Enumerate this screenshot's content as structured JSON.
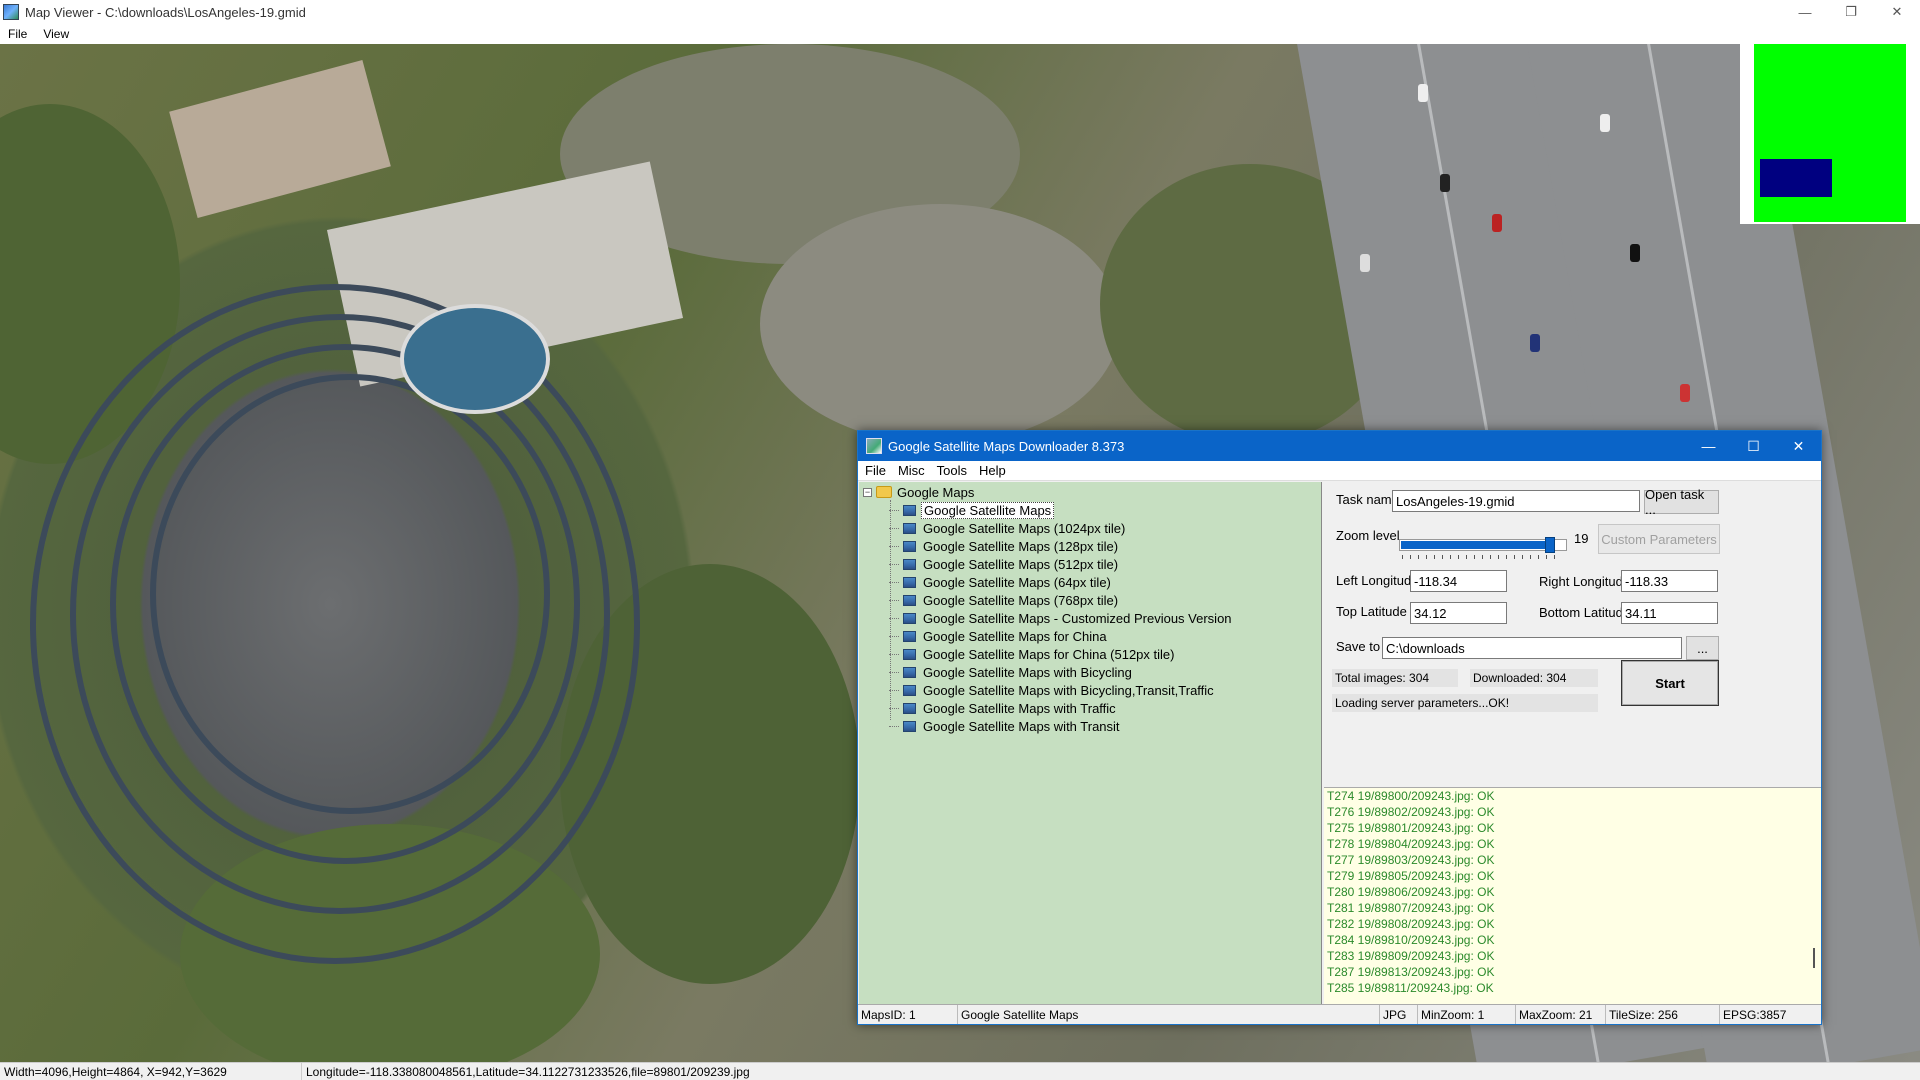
{
  "viewer": {
    "title": "Map Viewer - C:\\downloads\\LosAngeles-19.gmid",
    "menu": [
      "File",
      "View"
    ],
    "window_controls": {
      "minimize": "—",
      "restore": "❐",
      "close": "✕"
    },
    "status": {
      "dims": "Width=4096,Height=4864, X=942,Y=3629",
      "coords": "Longitude=-118.338080048561,Latitude=34.1122731233526,file=89801/209239.jpg"
    }
  },
  "downloader": {
    "title": "Google Satellite Maps Downloader 8.373",
    "window_controls": {
      "minimize": "—",
      "maximize": "☐",
      "close": "✕"
    },
    "menu": [
      "File",
      "Misc",
      "Tools",
      "Help"
    ],
    "tree": {
      "root": "Google Maps",
      "items": [
        "Google Satellite Maps",
        "Google Satellite Maps (1024px tile)",
        "Google Satellite Maps (128px tile)",
        "Google Satellite Maps (512px tile)",
        "Google Satellite Maps (64px tile)",
        "Google Satellite Maps (768px tile)",
        "Google Satellite Maps - Customized Previous Version",
        "Google Satellite Maps for China",
        "Google Satellite Maps for China (512px tile)",
        "Google Satellite Maps with Bicycling",
        "Google Satellite Maps with Bicycling,Transit,Traffic",
        "Google Satellite Maps with Traffic",
        "Google Satellite Maps with Transit"
      ],
      "selected_index": 0
    },
    "form": {
      "task_name_label": "Task name",
      "task_name_value": "LosAngeles-19.gmid",
      "open_task_button": "Open task ...",
      "zoom_label": "Zoom level",
      "zoom_value": "19",
      "zoom_min": 1,
      "zoom_max": 21,
      "custom_params_button": "Custom Parameters",
      "left_lon_label": "Left Longitude",
      "left_lon_value": "-118.34",
      "right_lon_label": "Right Longitude",
      "right_lon_value": "-118.33",
      "top_lat_label": "Top Latitude",
      "top_lat_value": "34.12",
      "bottom_lat_label": "Bottom Latitude",
      "bottom_lat_value": "34.11",
      "save_to_label": "Save to",
      "save_to_value": "C:\\downloads",
      "browse_button": "...",
      "total_images": "Total images: 304",
      "downloaded": "Downloaded: 304",
      "loading": "Loading server parameters...OK!",
      "start_button": "Start"
    },
    "log": [
      "T274 19/89800/209243.jpg: OK",
      "T276 19/89802/209243.jpg: OK",
      "T275 19/89801/209243.jpg: OK",
      "T278 19/89804/209243.jpg: OK",
      "T277 19/89803/209243.jpg: OK",
      "T279 19/89805/209243.jpg: OK",
      "T280 19/89806/209243.jpg: OK",
      "T281 19/89807/209243.jpg: OK",
      "T282 19/89808/209243.jpg: OK",
      "T284 19/89810/209243.jpg: OK",
      "T283 19/89809/209243.jpg: OK",
      "T287 19/89813/209243.jpg: OK",
      "T285 19/89811/209243.jpg: OK"
    ],
    "status": {
      "maps_id": "MapsID: 1",
      "map_name": "Google Satellite Maps",
      "format": "JPG",
      "min_zoom": "MinZoom: 1",
      "max_zoom": "MaxZoom: 21",
      "tile_size": "TileSize: 256",
      "epsg": "EPSG:3857"
    }
  },
  "colors": {
    "dialog_title": "#0a64c8",
    "tree_bg": "#c6dfc1",
    "log_bg": "#ffffe5",
    "log_text": "#2b8a2b",
    "overview_green": "#00ff00",
    "overview_viewport": "#000080"
  }
}
